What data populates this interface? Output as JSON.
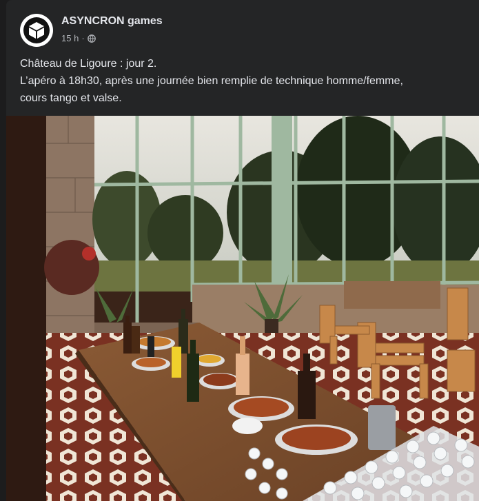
{
  "post": {
    "page_name": "ASYNCRON games",
    "timestamp": "15 h",
    "separator": "·",
    "audience_icon": "globe-icon",
    "caption_lines": [
      "Château de Ligoure : jour 2.",
      "L’apéro à 18h30, après une journée bien remplie de technique homme/femme,",
      "cours tango et valse."
    ]
  },
  "colors": {
    "background": "#1c1c1d",
    "card": "#242526",
    "primary_text": "#e4e6eb",
    "secondary_text": "#b0b3b8"
  }
}
